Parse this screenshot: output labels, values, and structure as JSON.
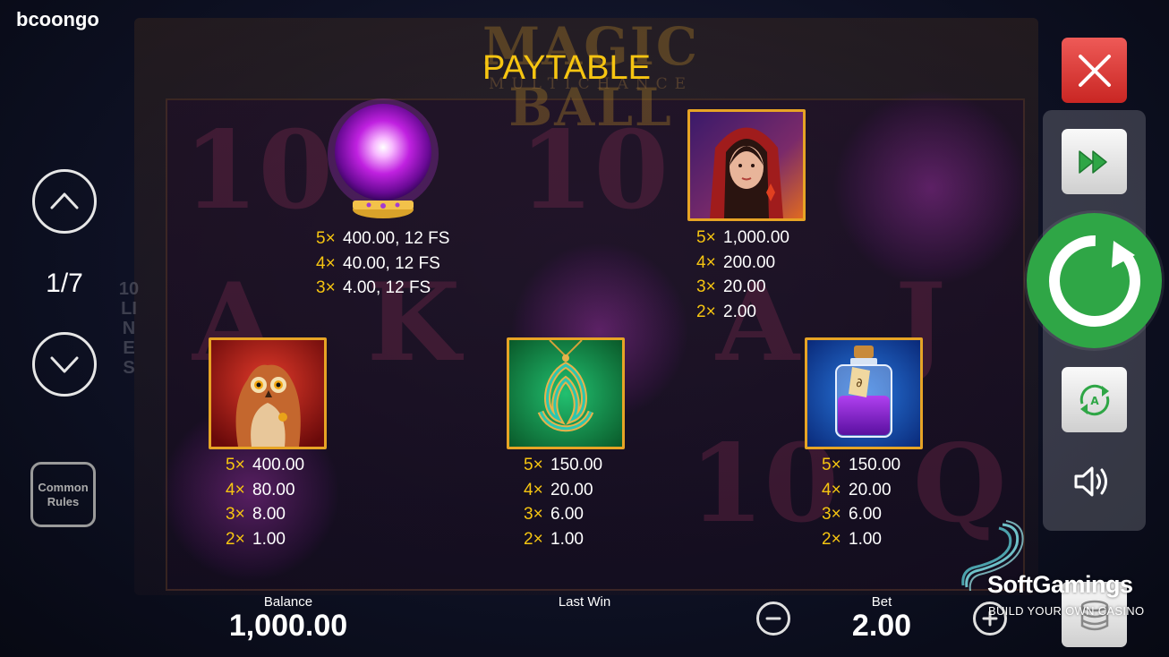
{
  "provider": {
    "logo_text": "booongo",
    "logo_text_display": "bcoongo"
  },
  "game_logo": {
    "title": "MAGIC BALL",
    "subtitle": "MULTICHANCE",
    "lines_label": "10 LINES"
  },
  "page": {
    "title": "PAYTABLE",
    "indicator": "1/7"
  },
  "symbols": [
    {
      "name": "crystal-ball",
      "pays": [
        {
          "count": "5×",
          "value": "400.00, 12 FS"
        },
        {
          "count": "4×",
          "value": "40.00, 12 FS"
        },
        {
          "count": "3×",
          "value": "4.00, 12 FS"
        }
      ]
    },
    {
      "name": "sorceress",
      "pays": [
        {
          "count": "5×",
          "value": "1,000.00"
        },
        {
          "count": "4×",
          "value": "200.00"
        },
        {
          "count": "3×",
          "value": "20.00"
        },
        {
          "count": "2×",
          "value": "2.00"
        }
      ]
    },
    {
      "name": "owl",
      "pays": [
        {
          "count": "5×",
          "value": "400.00"
        },
        {
          "count": "4×",
          "value": "80.00"
        },
        {
          "count": "3×",
          "value": "8.00"
        },
        {
          "count": "2×",
          "value": "1.00"
        }
      ]
    },
    {
      "name": "celtic-amulet",
      "pays": [
        {
          "count": "5×",
          "value": "150.00"
        },
        {
          "count": "4×",
          "value": "20.00"
        },
        {
          "count": "3×",
          "value": "6.00"
        },
        {
          "count": "2×",
          "value": "1.00"
        }
      ]
    },
    {
      "name": "potion-bottle",
      "pays": [
        {
          "count": "5×",
          "value": "150.00"
        },
        {
          "count": "4×",
          "value": "20.00"
        },
        {
          "count": "3×",
          "value": "6.00"
        },
        {
          "count": "2×",
          "value": "1.00"
        }
      ]
    }
  ],
  "nav": {
    "common_rules_line1": "Common",
    "common_rules_line2": "Rules"
  },
  "controls": {
    "icons": [
      "close-icon",
      "fast-forward-icon",
      "spin-icon",
      "autoplay-icon",
      "sound-icon",
      "coins-icon",
      "minus-icon",
      "plus-icon",
      "chevron-up-icon",
      "chevron-down-icon"
    ]
  },
  "bottom_bar": {
    "balance_label": "Balance",
    "balance_value": "1,000.00",
    "last_win_label": "Last Win",
    "bet_label": "Bet",
    "bet_value": "2.00"
  },
  "watermark": {
    "name": "SoftGamings",
    "tagline": "BUILD YOUR OWN CASINO"
  },
  "colors": {
    "accent_gold": "#f6c511",
    "spin_green": "#2fa646",
    "close_red": "#d9302d",
    "card_border": "#e7a425"
  }
}
